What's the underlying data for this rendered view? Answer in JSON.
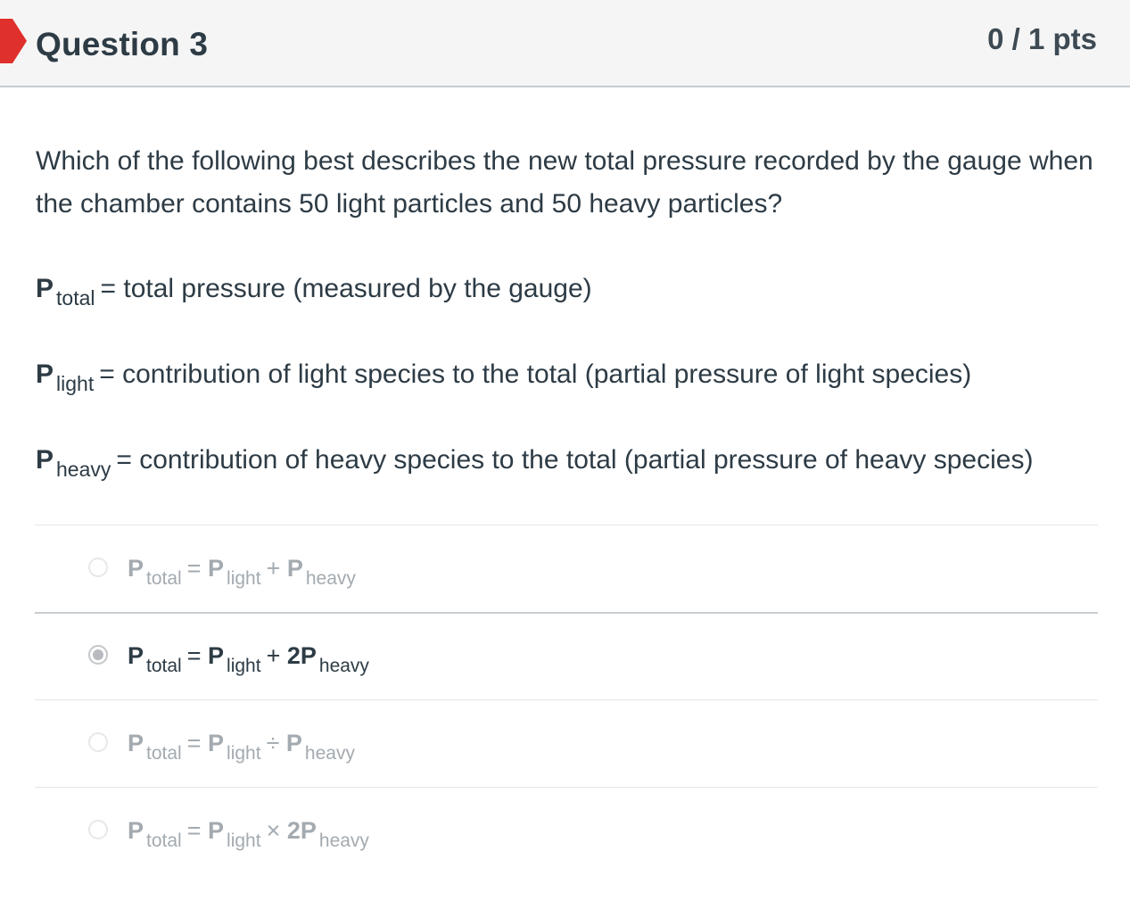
{
  "question": {
    "title": "Question 3",
    "points": "0 / 1 pts",
    "status_color": "#e0302b",
    "text": "Which of the following best describes the new total pressure recorded by the gauge when the chamber contains 50 light particles and 50 heavy particles?"
  },
  "definitions": [
    {
      "symbol": "P",
      "subscript": "total",
      "text": "= total pressure (measured by the gauge)"
    },
    {
      "symbol": "P",
      "subscript": "light",
      "text": "= contribution of light species to the total (partial pressure of light species)"
    },
    {
      "symbol": "P",
      "subscript": "heavy",
      "text": "= contribution of heavy species to the total (partial pressure of heavy species)"
    }
  ],
  "answers": [
    {
      "selected": false,
      "p1": "P",
      "s1": "total",
      "op1": "=",
      "p2": "P",
      "s2": "light",
      "op2": "+",
      "p3": "P",
      "s3": "heavy"
    },
    {
      "selected": true,
      "p1": "P",
      "s1": "total",
      "op1": "=",
      "p2": "P",
      "s2": "light",
      "op2": "+",
      "p3": "2P",
      "s3": "heavy"
    },
    {
      "selected": false,
      "p1": "P",
      "s1": "total",
      "op1": "=",
      "p2": "P",
      "s2": "light",
      "op2": "÷",
      "p3": "P",
      "s3": "heavy"
    },
    {
      "selected": false,
      "p1": "P",
      "s1": "total",
      "op1": "=",
      "p2": "P",
      "s2": "light",
      "op2": "×",
      "p3": "2P",
      "s3": "heavy"
    }
  ]
}
